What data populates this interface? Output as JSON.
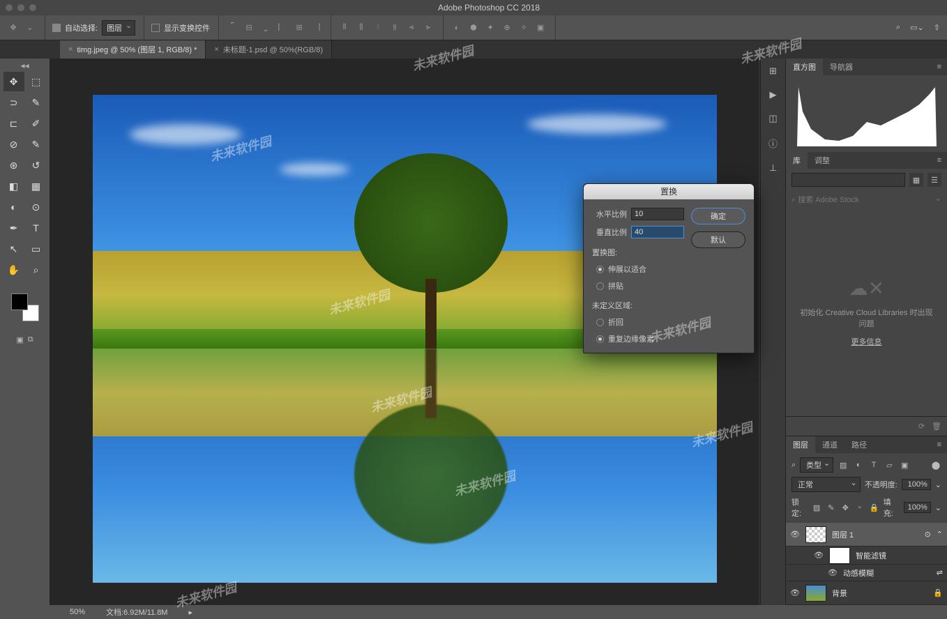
{
  "app_title": "Adobe Photoshop CC 2018",
  "options_bar": {
    "auto_select_label": "自动选择:",
    "auto_select_dropdown": "图层",
    "show_transform_label": "显示变换控件"
  },
  "tabs": [
    {
      "label": "timg.jpeg @ 50% (图层 1, RGB/8) *",
      "active": true
    },
    {
      "label": "未标题-1.psd @ 50%(RGB/8)",
      "active": false
    }
  ],
  "panels": {
    "histogram_tabs": [
      "直方图",
      "导航器"
    ],
    "lib_tabs": [
      "库",
      "调整"
    ],
    "stock_placeholder": "搜索 Adobe Stock",
    "cclib_msg": "初始化 Creative Cloud Libraries 时出现问题",
    "cclib_link": "更多信息",
    "layers_tabs": [
      "图层",
      "通道",
      "路径"
    ],
    "filter_type": "类型",
    "blend_mode": "正常",
    "opacity_label": "不透明度:",
    "opacity_value": "100%",
    "lock_label": "锁定:",
    "fill_label": "填充:",
    "fill_value": "100%",
    "layers": [
      {
        "name": "图层 1",
        "selected": true,
        "thumb": "checker"
      },
      {
        "name": "智能滤镜",
        "sub": 1
      },
      {
        "name": "动感模糊",
        "sub": 2
      },
      {
        "name": "背景",
        "locked": true,
        "thumb": "img"
      }
    ]
  },
  "dialog": {
    "title": "置换",
    "h_ratio_label": "水平比例",
    "h_ratio_value": "10",
    "v_ratio_label": "垂直比例",
    "v_ratio_value": "40",
    "map_section": "置换图:",
    "map_opt1": "伸展以适合",
    "map_opt2": "拼贴",
    "undef_section": "未定义区域:",
    "undef_opt1": "折回",
    "undef_opt2": "重复边缘像素",
    "ok": "确定",
    "default": "默认"
  },
  "status": {
    "zoom": "50%",
    "doc_info": "文档:6.92M/11.8M"
  },
  "watermark_text": "未来软件园"
}
